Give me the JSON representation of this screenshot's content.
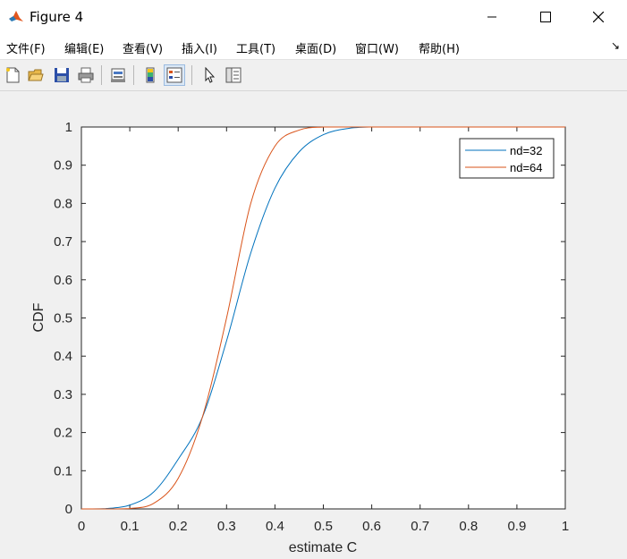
{
  "window": {
    "title": "Figure 4",
    "icon": "matlab-logo-icon"
  },
  "menu": [
    {
      "label": "文件(F)"
    },
    {
      "label": "编辑(E)"
    },
    {
      "label": "查看(V)"
    },
    {
      "label": "插入(I)"
    },
    {
      "label": "工具(T)"
    },
    {
      "label": "桌面(D)"
    },
    {
      "label": "窗口(W)"
    },
    {
      "label": "帮助(H)"
    }
  ],
  "toolbar": [
    "new-figure-icon",
    "open-file-icon",
    "save-icon",
    "print-icon",
    "link-plot-icon",
    "colorbar-icon",
    "legend-icon",
    "pointer-icon",
    "property-editor-icon"
  ],
  "colors": {
    "series1": "#0072bd",
    "series2": "#d95319"
  },
  "chart_data": {
    "type": "line",
    "xlabel": "estimate C",
    "ylabel": "CDF",
    "xlim": [
      0,
      1
    ],
    "ylim": [
      0,
      1
    ],
    "xticks": [
      "0",
      "0.1",
      "0.2",
      "0.3",
      "0.4",
      "0.5",
      "0.6",
      "0.7",
      "0.8",
      "0.9",
      "1"
    ],
    "yticks": [
      "0",
      "0.1",
      "0.2",
      "0.3",
      "0.4",
      "0.5",
      "0.6",
      "0.7",
      "0.8",
      "0.9",
      "1"
    ],
    "grid": false,
    "legend_position": "top-right",
    "series": [
      {
        "name": "nd=32",
        "color": "#0072bd",
        "x": [
          0,
          0.05,
          0.1,
          0.15,
          0.2,
          0.25,
          0.3,
          0.35,
          0.4,
          0.45,
          0.5,
          0.55,
          0.6,
          0.7,
          0.8,
          0.9,
          1
        ],
        "y": [
          0,
          0.001,
          0.01,
          0.045,
          0.13,
          0.24,
          0.44,
          0.67,
          0.84,
          0.935,
          0.98,
          0.996,
          1,
          1,
          1,
          1,
          1
        ]
      },
      {
        "name": "nd=64",
        "color": "#d95319",
        "x": [
          0,
          0.05,
          0.1,
          0.15,
          0.2,
          0.25,
          0.3,
          0.35,
          0.4,
          0.45,
          0.5,
          0.55,
          0.6,
          0.7,
          0.8,
          0.9,
          1
        ],
        "y": [
          0,
          0,
          0.001,
          0.015,
          0.08,
          0.24,
          0.5,
          0.8,
          0.95,
          0.992,
          1,
          1,
          1,
          1,
          1,
          1,
          1
        ]
      }
    ]
  }
}
